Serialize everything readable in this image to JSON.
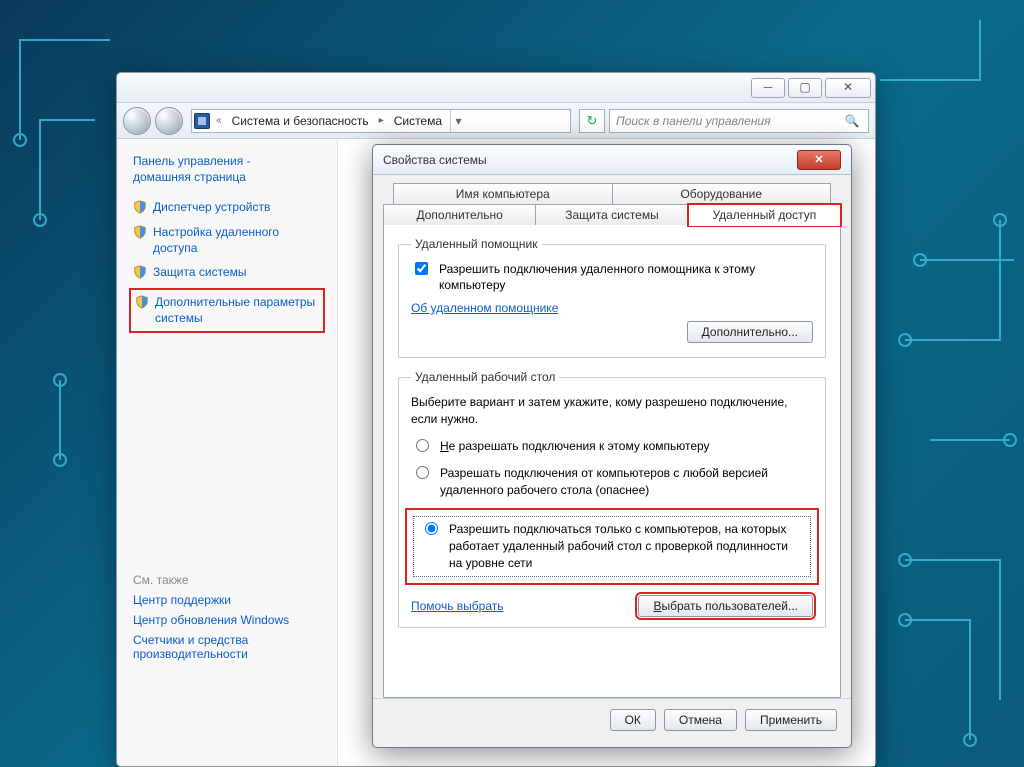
{
  "window": {
    "breadcrumb": {
      "seg1": "Система и безопасность",
      "seg2": "Система"
    },
    "search_placeholder": "Поиск в панели управления"
  },
  "sidebar": {
    "home_line1": "Панель управления -",
    "home_line2": "домашняя страница",
    "items": [
      {
        "label": "Диспетчер устройств"
      },
      {
        "label": "Настройка удаленного доступа"
      },
      {
        "label": "Защита системы"
      },
      {
        "label": "Дополнительные параметры системы"
      }
    ],
    "seealso_header": "См. также",
    "seealso": [
      "Центр поддержки",
      "Центр обновления Windows",
      "Счетчики и средства производительности"
    ]
  },
  "dialog": {
    "title": "Свойства системы",
    "tabs_row1": [
      "Имя компьютера",
      "Оборудование"
    ],
    "tabs_row2": [
      "Дополнительно",
      "Защита системы",
      "Удаленный доступ"
    ],
    "group1": {
      "legend": "Удаленный помощник",
      "checkbox_label": "Разрешить подключения удаленного помощника к этому компьютеру",
      "link": "Об удаленном помощнике",
      "btn": "Дополнительно..."
    },
    "group2": {
      "legend": "Удаленный рабочий стол",
      "intro": "Выберите вариант и затем укажите, кому разрешено подключение, если нужно.",
      "opt1": "Не разрешать подключения к этому компьютеру",
      "opt2": "Разрешать подключения от компьютеров с любой версией удаленного рабочего стола (опаснее)",
      "opt3": "Разрешить подключаться только с компьютеров, на которых работает удаленный рабочий стол с проверкой подлинности на уровне сети",
      "help_link": "Помочь выбрать",
      "btn_users": "Выбрать пользователей..."
    },
    "footer": {
      "ok": "ОК",
      "cancel": "Отмена",
      "apply": "Применить"
    }
  }
}
